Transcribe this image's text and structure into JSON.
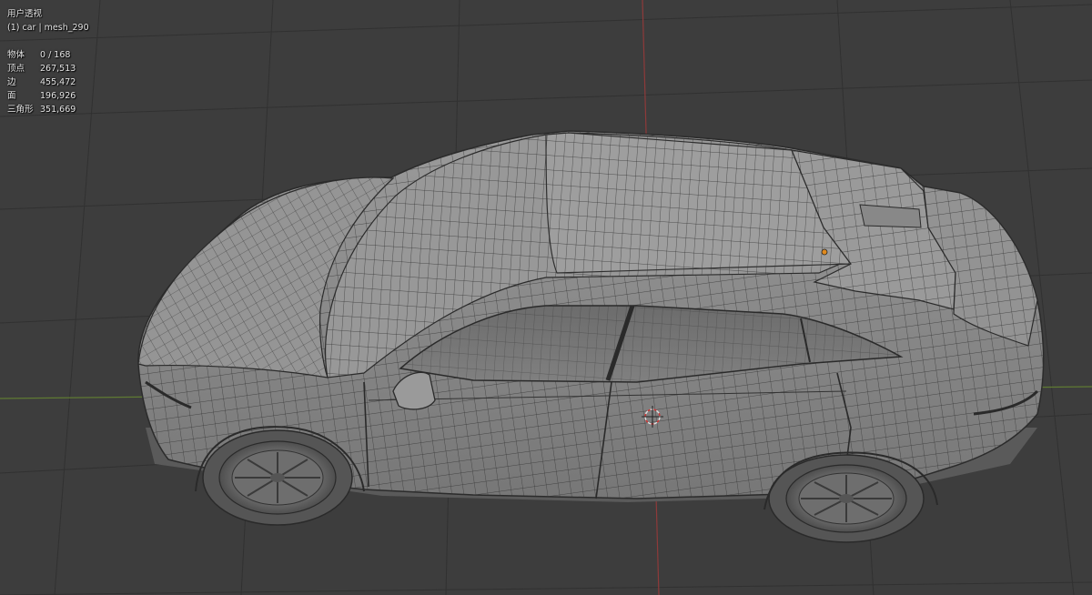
{
  "viewport": {
    "view_name": "用户透视",
    "object_line": "(1) car | mesh_290",
    "stats": [
      {
        "label": "物体",
        "value": "0 / 168"
      },
      {
        "label": "顶点",
        "value": "267,513"
      },
      {
        "label": "边",
        "value": "455,472"
      },
      {
        "label": "面",
        "value": "196,926"
      },
      {
        "label": "三角形",
        "value": "351,669"
      }
    ]
  },
  "colors": {
    "background": "#3d3d3d",
    "grid_line": "#303030",
    "axis_x": "#8a3b3b",
    "axis_y": "#6b8a3a",
    "mesh_fill": "#8d8d8d",
    "wire": "#2e2e2e",
    "origin_dot": "#e08a1e"
  }
}
